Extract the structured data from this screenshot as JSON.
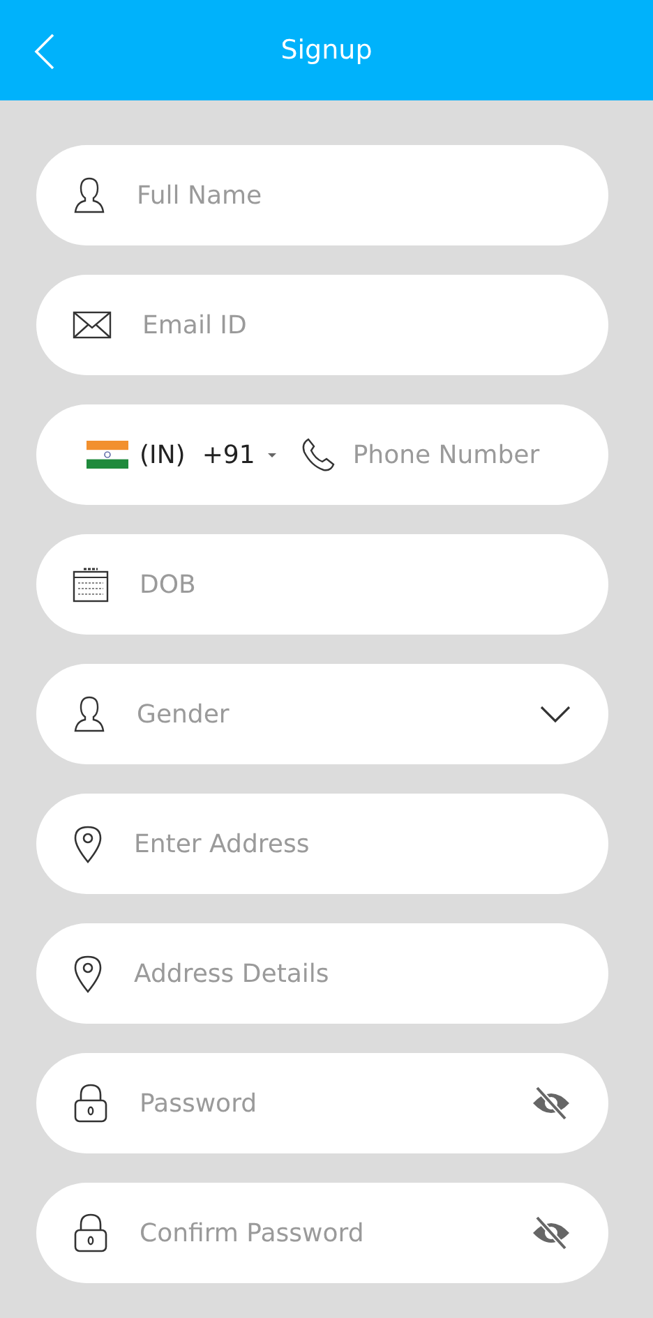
{
  "header": {
    "title": "Signup"
  },
  "fields": [
    {
      "kind": "name",
      "placeholder": "Full Name"
    },
    {
      "kind": "email",
      "placeholder": "Email ID"
    },
    {
      "kind": "phone",
      "country": "(IN)",
      "dial_code": "+91",
      "placeholder": "Phone Number"
    },
    {
      "kind": "date",
      "placeholder": "DOB"
    },
    {
      "kind": "dropdown",
      "placeholder": "Gender"
    },
    {
      "kind": "address",
      "placeholder": "Enter Address"
    },
    {
      "kind": "address",
      "placeholder": "Address Details"
    },
    {
      "kind": "password",
      "placeholder": "Password",
      "visible": false
    },
    {
      "kind": "password",
      "placeholder": "Confirm Password",
      "visible": false
    }
  ]
}
